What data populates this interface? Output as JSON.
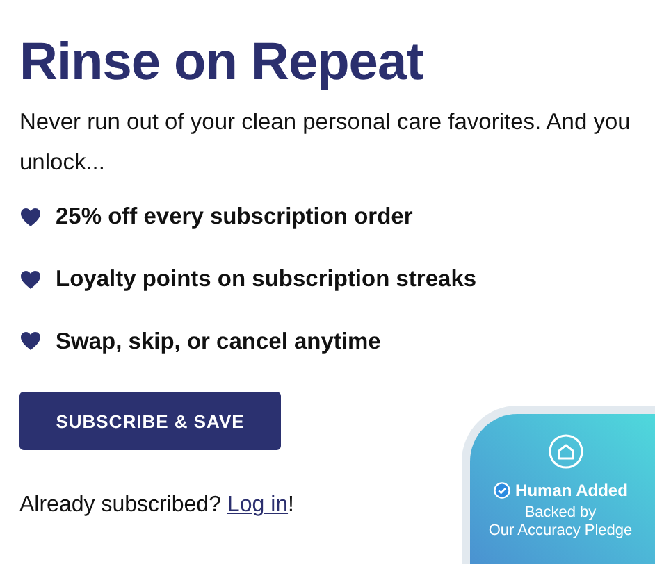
{
  "heading": "Rinse on Repeat",
  "intro": "Never run out of your clean personal care favorites. And you unlock...",
  "benefits": [
    "25% off every subscription order",
    "Loyalty points on subscription streaks",
    "Swap, skip, or cancel anytime"
  ],
  "cta_button": "SUBSCRIBE & SAVE",
  "login_prompt": {
    "text": "Already subscribed?",
    "link": "Log in",
    "trailing": "!"
  },
  "badge": {
    "title": "Human Added",
    "subtitle_1": "Backed by",
    "subtitle_2": "Our Accuracy Pledge"
  }
}
